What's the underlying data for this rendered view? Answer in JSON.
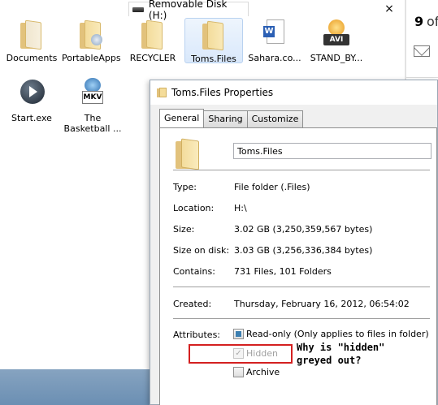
{
  "explorer": {
    "tab_title": "Removable Disk (H:)",
    "close_glyph": "×",
    "items": [
      {
        "label": "Documents",
        "icon": "folder-icon"
      },
      {
        "label": "PortableApps",
        "icon": "folder-gear-icon"
      },
      {
        "label": "RECYCLER",
        "icon": "folder-icon"
      },
      {
        "label": "Toms.Files",
        "icon": "folder-icon",
        "selected": true
      },
      {
        "label": "Sahara.co...",
        "icon": "word-document-icon"
      },
      {
        "label": "STAND_BY...",
        "icon": "avi-video-icon"
      },
      {
        "label": "Start.exe",
        "icon": "start-exe-icon"
      },
      {
        "label": "The",
        "label2": "Basketball ...",
        "icon": "mkv-video-icon"
      }
    ]
  },
  "right_panel": {
    "count": "9",
    "count_suffix": "of"
  },
  "properties": {
    "title": "Toms.Files Properties",
    "tabs": [
      "General",
      "Sharing",
      "Customize"
    ],
    "active_tab": "General",
    "name_value": "Toms.Files",
    "rows": {
      "type_label": "Type:",
      "type_value": "File folder (.Files)",
      "location_label": "Location:",
      "location_value": "H:\\",
      "size_label": "Size:",
      "size_value": "3.02 GB (3,250,359,567 bytes)",
      "size_on_disk_label": "Size on disk:",
      "size_on_disk_value": "3.03 GB (3,256,336,384 bytes)",
      "contains_label": "Contains:",
      "contains_value": "731 Files, 101 Folders",
      "created_label": "Created:",
      "created_value": "Thursday, February 16, 2012, 06:54:02",
      "attributes_label": "Attributes:"
    },
    "attributes": {
      "readonly_label": "Read-only (Only applies to files in folder)",
      "hidden_label": "Hidden",
      "archive_label": "Archive",
      "hidden_check_glyph": "✓"
    }
  },
  "annotation": {
    "line1": "Why is \"hidden\"",
    "line2": "greyed out?"
  },
  "colors": {
    "highlight_border": "#d42020",
    "selection_bg": "#d9e8fb",
    "folder": "#f3dc9c"
  }
}
